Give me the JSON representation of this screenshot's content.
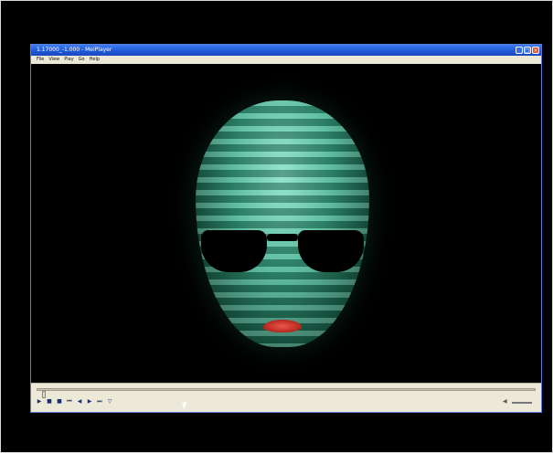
{
  "window": {
    "title": "1.17000_-1.000 - MeiPlayer",
    "controls": [
      "_",
      "□",
      "×"
    ]
  },
  "menu": [
    "File",
    "View",
    "Play",
    "Go",
    "Help"
  ],
  "player": {
    "buttons": [
      "▶",
      "■",
      "■",
      "⏮",
      "◀",
      "▶",
      "⏭",
      "▽"
    ],
    "seek_position": 0.01
  },
  "icons": {
    "volume": "speaker-icon"
  }
}
